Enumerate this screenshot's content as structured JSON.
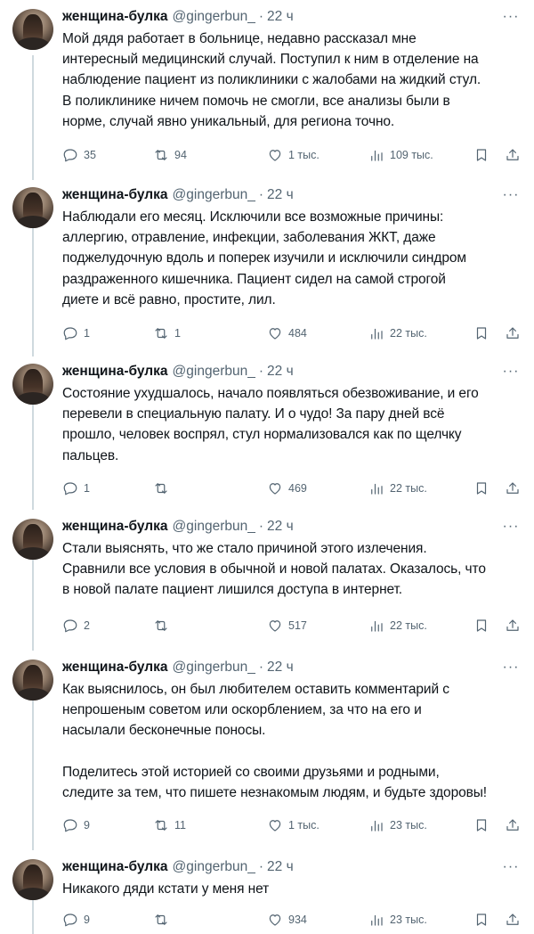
{
  "tweets": [
    {
      "name": "женщина-булка",
      "handle": "@gingerbun_",
      "time": "22 ч",
      "text": "Мой дядя работает в больнице, недавно рассказал мне\nинтересный медицинский случай. Поступил к ним в отделение на\nнаблюдение пациент из поликлиники с жалобами на жидкий стул.\nВ поликлинике ничем помочь не смогли, все анализы были в\nнорме, случай явно уникальный, для региона точно.",
      "replies": "35",
      "retweets": "94",
      "likes": "1 тыс.",
      "views": "109 тыс."
    },
    {
      "name": "женщина-булка",
      "handle": "@gingerbun_",
      "time": "22 ч",
      "text": "Наблюдали его месяц. Исключили все возможные причины:\nаллергию, отравление, инфекции, заболевания ЖКТ, даже\nподжелудочную вдоль и поперек изучили и исключили синдром\nраздраженного кишечника. Пациент сидел на самой строгой\nдиете и всё равно, простите, лил.",
      "replies": "1",
      "retweets": "1",
      "likes": "484",
      "views": "22 тыс."
    },
    {
      "name": "женщина-булка",
      "handle": "@gingerbun_",
      "time": "22 ч",
      "text": "Состояние ухудшалось, начало появляться обезвоживание, и его\nперевели в специальную палату. И о чудо! За пару дней всё\nпрошло, человек воспрял, стул нормализовался как по щелчку\nпальцев.",
      "replies": "1",
      "retweets": "",
      "likes": "469",
      "views": "22 тыс."
    },
    {
      "name": "женщина-булка",
      "handle": "@gingerbun_",
      "time": "22 ч",
      "text": "Стали выяснять, что же стало причиной этого излечения.\nСравнили все условия в обычной и новой палатах. Оказалось, что\nв новой палате пациент лишился доступа в интернет.",
      "replies": "2",
      "retweets": "",
      "likes": "517",
      "views": "22 тыс."
    },
    {
      "name": "женщина-булка",
      "handle": "@gingerbun_",
      "time": "22 ч",
      "text": "Как выяснилось, он был любителем оставить комментарий с\nнепрошеным советом или оскорблением, за что на его и\nнасылали бесконечные поносы.\n\nПоделитесь этой историей со своими друзьями и родными,\nследите за тем, что пишете незнакомым людям, и будьте здоровы!",
      "replies": "9",
      "retweets": "11",
      "likes": "1 тыс.",
      "views": "23 тыс."
    },
    {
      "name": "женщина-булка",
      "handle": "@gingerbun_",
      "time": "22 ч",
      "text": "Никакого дяди кстати у меня нет",
      "replies": "9",
      "retweets": "",
      "likes": "934",
      "views": "23 тыс."
    }
  ],
  "ui": {
    "separator": "·",
    "more": "···"
  },
  "icons": {
    "reply": "reply-icon",
    "retweet": "retweet-icon",
    "like": "heart-icon",
    "views": "views-chart-icon",
    "bookmark": "bookmark-icon",
    "share": "share-icon",
    "more": "more-icon"
  }
}
